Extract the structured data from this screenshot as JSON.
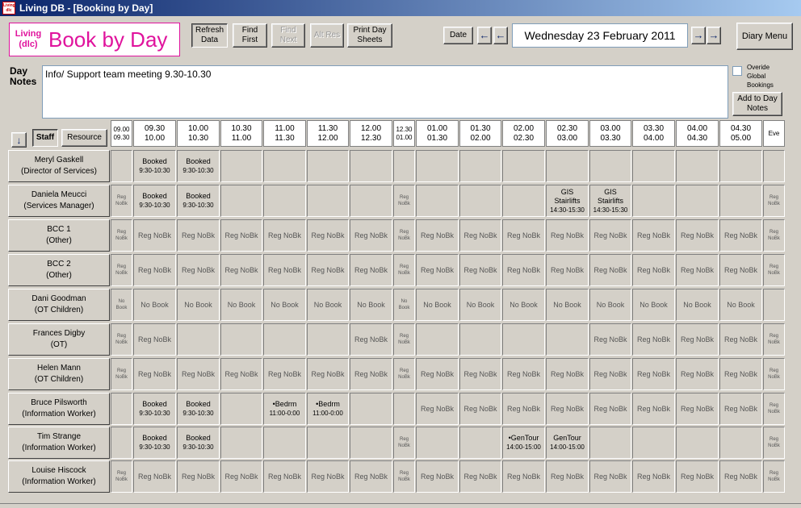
{
  "window": {
    "title": "Living DB - [Booking by Day]",
    "app_icon_text": "Living dlc"
  },
  "logo": {
    "line1": "Living",
    "line2": "(dlc)",
    "title": "Book by Day"
  },
  "toolbar": {
    "refresh": "Refresh Data",
    "find_first": "Find First",
    "find_next": "Find Next",
    "alt_res": "Alt Res",
    "print": "Print Day Sheets",
    "date_btn": "Date",
    "prev_week": "←",
    "prev_day": "←",
    "next_day": "→",
    "next_week": "→",
    "current_date": "Wednesday 23 February 2011",
    "diary_menu": "Diary Menu"
  },
  "daynotes": {
    "label1": "Day",
    "label2": "Notes",
    "text": "Info/ Support team meeting 9.30-10.30",
    "override_line1": "Overide",
    "override_line2": "Global",
    "override_line3": "Bookings",
    "add_btn": "Add to Day Notes"
  },
  "grid_controls": {
    "down_arrow": "↓",
    "staff": "Staff",
    "resource": "Resource"
  },
  "slots": [
    {
      "top": "09.00",
      "bottom": "09.30",
      "narrow": true
    },
    {
      "top": "09.30",
      "bottom": "10.00"
    },
    {
      "top": "10.00",
      "bottom": "10.30"
    },
    {
      "top": "10.30",
      "bottom": "11.00"
    },
    {
      "top": "11.00",
      "bottom": "11.30"
    },
    {
      "top": "11.30",
      "bottom": "12.00"
    },
    {
      "top": "12.00",
      "bottom": "12.30"
    },
    {
      "top": "12.30",
      "bottom": "01.00",
      "narrow": true
    },
    {
      "top": "01.00",
      "bottom": "01.30"
    },
    {
      "top": "01.30",
      "bottom": "02.00"
    },
    {
      "top": "02.00",
      "bottom": "02.30"
    },
    {
      "top": "02.30",
      "bottom": "03.00"
    },
    {
      "top": "03.00",
      "bottom": "03.30"
    },
    {
      "top": "03.30",
      "bottom": "04.00"
    },
    {
      "top": "04.00",
      "bottom": "04.30"
    },
    {
      "top": "04.30",
      "bottom": "05.00"
    },
    {
      "top": "Eve",
      "bottom": "",
      "narrow": true
    }
  ],
  "rows": [
    {
      "name": "Meryl Gaskell",
      "role": "(Director of Services)",
      "cells": [
        "",
        "Booked|9:30-10:30",
        "Booked|9:30-10:30",
        "",
        "",
        "",
        "",
        "",
        "",
        "",
        "",
        "",
        "",
        "",
        "",
        "",
        ""
      ]
    },
    {
      "name": "Daniela Meucci",
      "role": "(Services Manager)",
      "cells": [
        "Reg NoBk",
        "Booked|9:30-10:30",
        "Booked|9:30-10:30",
        "",
        "",
        "",
        "",
        "Reg NoBk",
        "",
        "",
        "",
        "GIS|Stairlifts|14:30-15:30",
        "GIS|Stairlifts|14:30-15:30",
        "",
        "",
        "",
        "Reg NoBk"
      ]
    },
    {
      "name": "BCC  1",
      "role": "(Other)",
      "cells": [
        "Reg NoBk",
        "Reg NoBk",
        "Reg NoBk",
        "Reg NoBk",
        "Reg NoBk",
        "Reg NoBk",
        "Reg NoBk",
        "Reg NoBk",
        "Reg NoBk",
        "Reg NoBk",
        "Reg NoBk",
        "Reg NoBk",
        "Reg NoBk",
        "Reg NoBk",
        "Reg NoBk",
        "Reg NoBk",
        "Reg NoBk"
      ]
    },
    {
      "name": "BCC  2",
      "role": "(Other)",
      "cells": [
        "Reg NoBk",
        "Reg NoBk",
        "Reg NoBk",
        "Reg NoBk",
        "Reg NoBk",
        "Reg NoBk",
        "Reg NoBk",
        "Reg NoBk",
        "Reg NoBk",
        "Reg NoBk",
        "Reg NoBk",
        "Reg NoBk",
        "Reg NoBk",
        "Reg NoBk",
        "Reg NoBk",
        "Reg NoBk",
        "Reg NoBk"
      ]
    },
    {
      "name": "Dani Goodman",
      "role": "(OT Children)",
      "cells": [
        "No Book",
        "No Book",
        "No Book",
        "No Book",
        "No Book",
        "No Book",
        "No Book",
        "No Book",
        "No Book",
        "No Book",
        "No Book",
        "No Book",
        "No Book",
        "No Book",
        "No Book",
        "No Book",
        ""
      ]
    },
    {
      "name": "Frances Digby",
      "role": "(OT)",
      "cells": [
        "Reg NoBk",
        "Reg NoBk",
        "",
        "",
        "",
        "",
        "Reg NoBk",
        "Reg NoBk",
        "",
        "",
        "",
        "",
        "Reg NoBk",
        "Reg NoBk",
        "Reg NoBk",
        "Reg NoBk",
        "Reg NoBk"
      ]
    },
    {
      "name": "Helen Mann",
      "role": "(OT Children)",
      "cells": [
        "Reg NoBk",
        "Reg NoBk",
        "Reg NoBk",
        "Reg NoBk",
        "Reg NoBk",
        "Reg NoBk",
        "Reg NoBk",
        "Reg NoBk",
        "Reg NoBk",
        "Reg NoBk",
        "Reg NoBk",
        "Reg NoBk",
        "Reg NoBk",
        "Reg NoBk",
        "Reg NoBk",
        "Reg NoBk",
        "Reg NoBk"
      ]
    },
    {
      "name": "Bruce Pilsworth",
      "role": "(Information Worker)",
      "cells": [
        "",
        "Booked|9:30-10:30",
        "Booked|9:30-10:30",
        "",
        "•Bedrm|11:00-0:00",
        "•Bedrm|11:00-0:00",
        "",
        "",
        "Reg NoBk",
        "Reg NoBk",
        "Reg NoBk",
        "Reg NoBk",
        "Reg NoBk",
        "Reg NoBk",
        "Reg NoBk",
        "Reg NoBk",
        "Reg NoBk"
      ]
    },
    {
      "name": "Tim Strange",
      "role": "(Information Worker)",
      "cells": [
        "",
        "Booked|9:30-10:30",
        "Booked|9:30-10:30",
        "",
        "",
        "",
        "",
        "Reg NoBk",
        "",
        "",
        "•GenTour|14:00-15:00",
        "GenTour|14:00-15:00",
        "",
        "",
        "",
        "",
        "Reg NoBk"
      ]
    },
    {
      "name": "Louise Hiscock",
      "role": "(Information Worker)",
      "cells": [
        "Reg NoBk",
        "Reg NoBk",
        "Reg NoBk",
        "Reg NoBk",
        "Reg NoBk",
        "Reg NoBk",
        "Reg NoBk",
        "Reg NoBk",
        "Reg NoBk",
        "Reg NoBk",
        "Reg NoBk",
        "Reg NoBk",
        "Reg NoBk",
        "Reg NoBk",
        "Reg NoBk",
        "Reg NoBk",
        "Reg NoBk"
      ]
    }
  ]
}
